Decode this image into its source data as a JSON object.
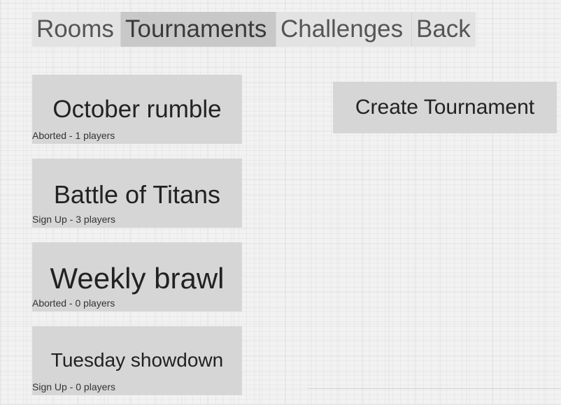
{
  "nav": {
    "tabs": [
      {
        "label": "Rooms"
      },
      {
        "label": "Tournaments"
      },
      {
        "label": "Challenges"
      },
      {
        "label": "Back"
      }
    ],
    "active": "Tournaments"
  },
  "tournaments": [
    {
      "name": "October rumble",
      "status": "Aborted - 1 players"
    },
    {
      "name": "Battle of Titans",
      "status": "Sign Up - 3 players"
    },
    {
      "name": "Weekly brawl",
      "status": "Aborted - 0 players"
    },
    {
      "name": "Tuesday showdown",
      "status": "Sign Up - 0 players"
    }
  ],
  "create_button": {
    "label": "Create Tournament"
  },
  "colors": {
    "tab_background": "#e3e3e3",
    "tab_active_background": "#c8c8c8",
    "card_background": "#d6d6d6",
    "text": "#222222"
  }
}
